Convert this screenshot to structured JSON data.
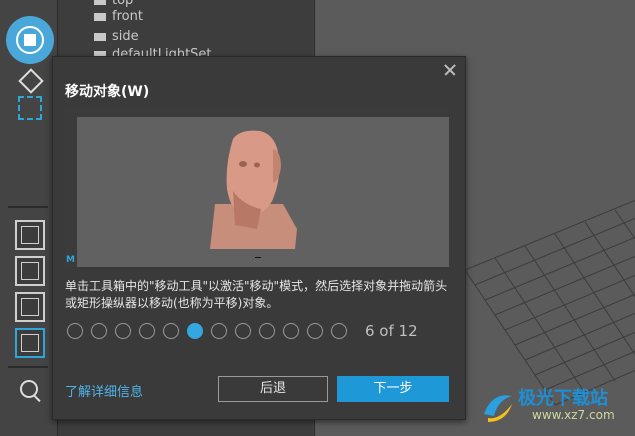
{
  "outliner": {
    "items": [
      {
        "label": "top"
      },
      {
        "label": "front"
      },
      {
        "label": "side"
      },
      {
        "label": "defaultLightSet"
      }
    ]
  },
  "dialog": {
    "title": "移动对象(W)",
    "description": "单击工具箱中的\"移动工具\"以激活\"移动\"模式，然后选择对象并拖动箭头或矩形操纵器以移动(也称为平移)对象。",
    "pager": {
      "current": 6,
      "total": 12,
      "label": "6 of 12"
    },
    "learn_more": "了解详细信息",
    "back_button": "后退",
    "next_button": "下一步"
  },
  "preview": {
    "app_logo": "M"
  },
  "watermark": {
    "text": "极光下载站",
    "url": "www.xz7.com"
  },
  "colors": {
    "accent": "#1f98d8",
    "link": "#4fb4ea",
    "dialog_bg": "#3a3a3a",
    "viewport_bg": "#5b5b5b"
  },
  "icons": [
    "move-tool-icon",
    "rotate-tool-icon",
    "scale-tool-icon",
    "camera-icon",
    "close-icon",
    "search-icon"
  ]
}
